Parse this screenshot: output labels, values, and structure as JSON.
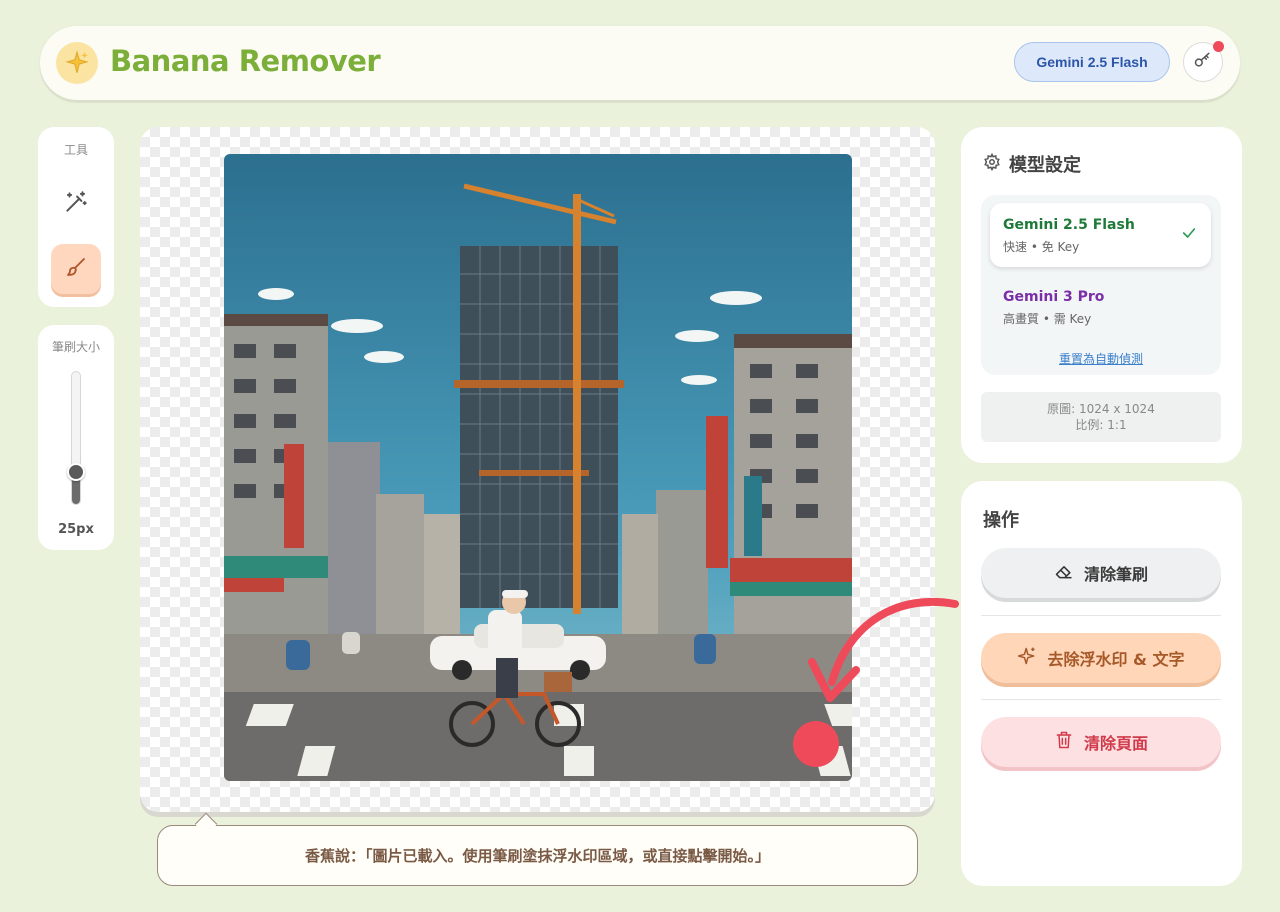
{
  "header": {
    "title": "Banana Remover",
    "model_badge": "Gemini 2.5 Flash",
    "logo_icon": "sparkle-icon",
    "key_icon": "key-icon"
  },
  "tools": {
    "label": "工具",
    "items": [
      {
        "name": "magic-wand",
        "icon": "magic-wand-icon",
        "active": false
      },
      {
        "name": "brush",
        "icon": "brush-icon",
        "active": true
      }
    ]
  },
  "brush": {
    "label": "筆刷大小",
    "value_label": "25px",
    "level": 0.25
  },
  "canvas": {
    "image_description": "pixel-art city street",
    "checker": true
  },
  "speech": {
    "text": "香蕉說：「圖片已載入。使用筆刷塗抹浮水印區域，或直接點擊開始。」"
  },
  "model_settings": {
    "title": "模型設定",
    "options": [
      {
        "name": "Gemini 2.5 Flash",
        "sub": "快速 • 免 Key",
        "selected": true,
        "color": "#1f7a3a"
      },
      {
        "name": "Gemini 3 Pro",
        "sub": "高畫質 • 需 Key",
        "selected": false,
        "color": "#7a2fa8"
      }
    ],
    "reset_link": "重置為自動偵測",
    "info_line1": "原圖: 1024 x 1024",
    "info_line2": "比例: 1:1"
  },
  "operations": {
    "title": "操作",
    "clear_brush": "清除筆刷",
    "remove_watermark": "去除浮水印 & 文字",
    "clear_page": "清除頁面"
  },
  "colors": {
    "background": "#eaf2dc",
    "brand_green": "#7cae3a",
    "accent_orange": "#ffd6b8",
    "danger_red": "#d13a4a",
    "annotation_red": "#ef4a5a"
  }
}
